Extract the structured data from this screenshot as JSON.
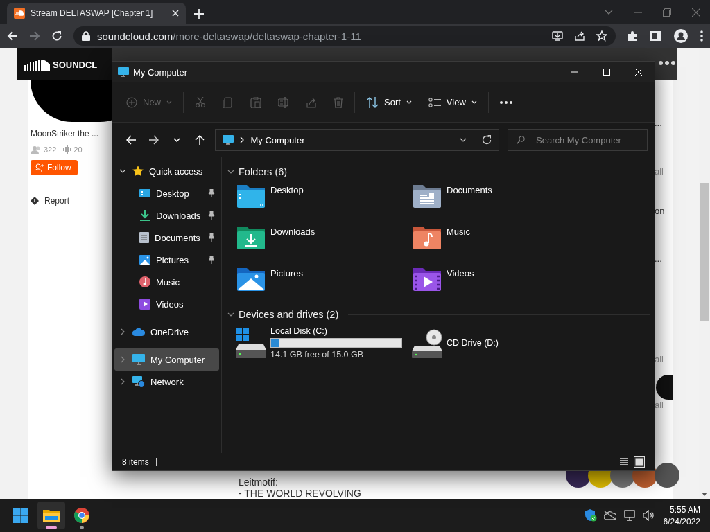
{
  "browser": {
    "tab_title": "Stream DELTASWAP [Chapter 1]",
    "url_host": "soundcloud.com",
    "url_path": "/more-deltaswap/deltaswap-chapter-1-11",
    "forward_disabled": true
  },
  "page": {
    "logo": "SOUNDCL",
    "artist": "MoonStriker the ...",
    "followers": "322",
    "tracks": "20",
    "follow_button": "Follow",
    "report": "Report",
    "right_snippets": [
      "...",
      "all",
      "on",
      "...",
      "all",
      "all"
    ],
    "description": [
      "Leitmotif:",
      "- THE WORLD REVOLVING"
    ]
  },
  "explorer": {
    "title": "My Computer",
    "toolbar": [
      {
        "kind": "new",
        "label": "New",
        "disabled": true
      },
      {
        "kind": "cut",
        "disabled": true
      },
      {
        "kind": "copy",
        "disabled": true
      },
      {
        "kind": "paste",
        "disabled": true
      },
      {
        "kind": "rename",
        "disabled": true
      },
      {
        "kind": "share",
        "disabled": true
      },
      {
        "kind": "delete",
        "disabled": true
      },
      {
        "kind": "sort",
        "label": "Sort",
        "disabled": false
      },
      {
        "kind": "view",
        "label": "View",
        "disabled": false
      },
      {
        "kind": "more",
        "disabled": false
      }
    ],
    "address": "My Computer",
    "search": {
      "placeholder": "Search My Computer"
    },
    "nav": [
      {
        "label": "Quick access",
        "kind": "star",
        "expanded": true,
        "selected": false,
        "children": [
          {
            "label": "Desktop",
            "kind": "desktop",
            "pinned": true,
            "selected": false
          },
          {
            "label": "Downloads",
            "kind": "downloads",
            "pinned": true,
            "selected": false
          },
          {
            "label": "Documents",
            "kind": "documents",
            "pinned": true,
            "selected": false
          },
          {
            "label": "Pictures",
            "kind": "pictures",
            "pinned": true,
            "selected": false
          },
          {
            "label": "Music",
            "kind": "music",
            "pinned": false,
            "selected": false
          },
          {
            "label": "Videos",
            "kind": "videos",
            "pinned": false,
            "selected": false
          }
        ]
      },
      {
        "label": "OneDrive",
        "kind": "onedrive",
        "expanded": false,
        "selected": false
      },
      {
        "label": "My Computer",
        "kind": "computer",
        "expanded": false,
        "selected": true
      },
      {
        "label": "Network",
        "kind": "network",
        "expanded": false,
        "selected": false
      }
    ],
    "folders": {
      "title": "Folders (6)",
      "expanded": true,
      "items": [
        {
          "name": "Desktop",
          "kind": "desktop"
        },
        {
          "name": "Documents",
          "kind": "documents"
        },
        {
          "name": "Downloads",
          "kind": "downloads"
        },
        {
          "name": "Music",
          "kind": "music"
        },
        {
          "name": "Pictures",
          "kind": "pictures"
        },
        {
          "name": "Videos",
          "kind": "videos"
        }
      ]
    },
    "drives": {
      "title": "Devices and drives (2)",
      "expanded": true,
      "items": [
        {
          "name": "Local Disk (C:)",
          "kind": "disk",
          "level": 0.06,
          "free": "14.1 GB free of 15.0 GB"
        },
        {
          "name": "CD Drive (D:)",
          "kind": "cd"
        }
      ]
    },
    "status": "8 items",
    "views": [
      {
        "kind": "details",
        "selected": false
      },
      {
        "kind": "tiles",
        "selected": true
      }
    ]
  },
  "taskbar": {
    "apps": [
      {
        "kind": "start",
        "active": false,
        "running": false
      },
      {
        "kind": "explorer",
        "active": true,
        "running": true
      },
      {
        "kind": "chrome",
        "active": false,
        "running": true
      }
    ],
    "time": "5:55 AM",
    "date": "6/24/2022"
  }
}
